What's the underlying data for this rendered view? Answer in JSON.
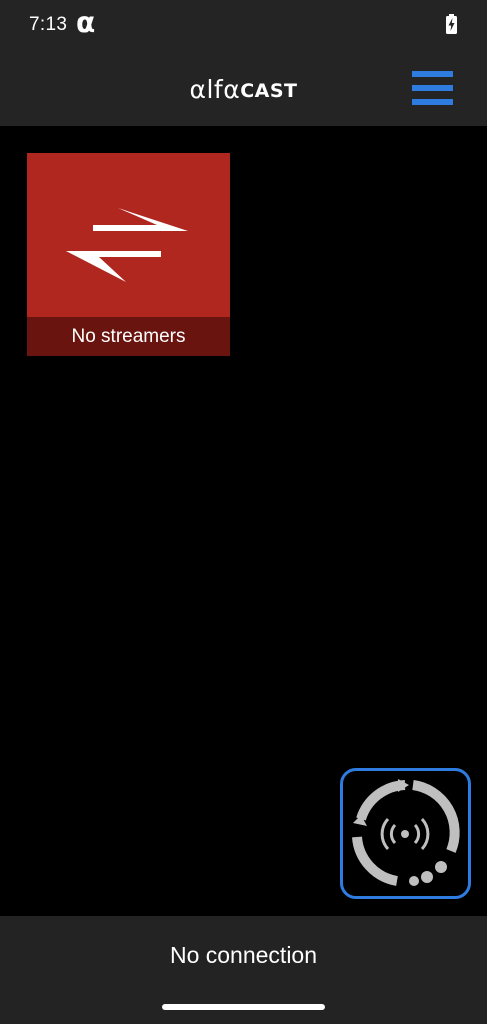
{
  "status_bar": {
    "time": "7:13",
    "alpha_glyph": "α",
    "battery_icon": "battery-charging-icon"
  },
  "app_bar": {
    "brand_prefix": "αlfα",
    "brand_suffix": "CAST",
    "menu_icon": "hamburger-menu-icon",
    "accent_color": "#2f7ce0"
  },
  "tiles": [
    {
      "label": "No streamers",
      "icon": "swap-arrows-icon",
      "color": "#b0271f"
    }
  ],
  "connect_button": {
    "icon": "broadcast-radar-icon"
  },
  "bottom_bar": {
    "status": "No connection"
  }
}
